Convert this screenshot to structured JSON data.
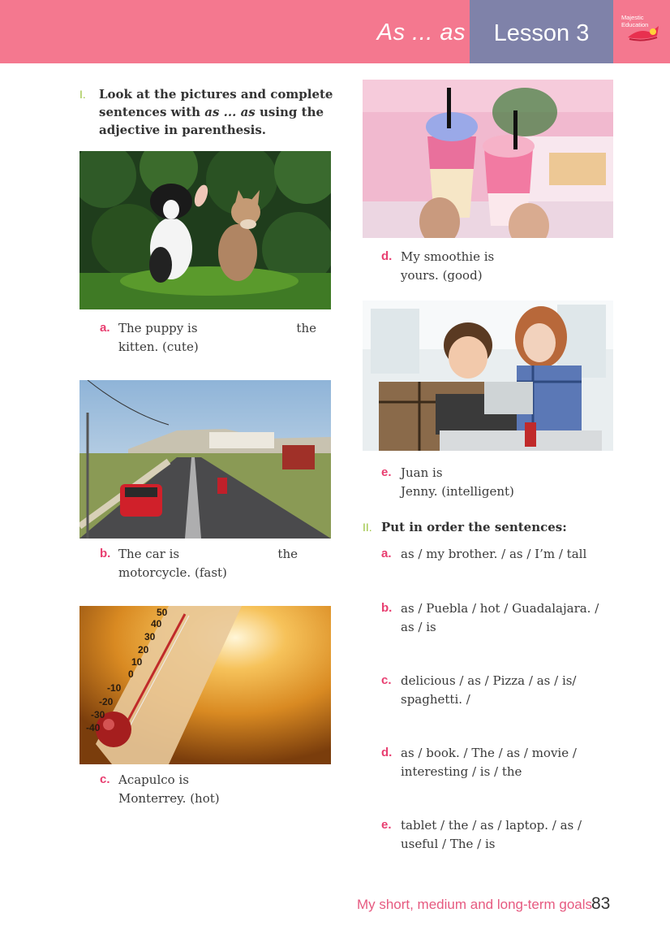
{
  "header": {
    "topic": "As ... as",
    "lesson": "Lesson 3",
    "logo_line1": "Majestic",
    "logo_line2": "Education"
  },
  "section1": {
    "numeral": "I.",
    "line1": "Look at the pictures and complete",
    "line2_pre": "sentences with ",
    "line2_em": "as ... as",
    "line2_post": " using the",
    "line3": "adjective in parenthesis."
  },
  "exercises": [
    {
      "letter": "a.",
      "line1_start": "The puppy is",
      "line1_end": "the",
      "line2": "kitten. (cute)"
    },
    {
      "letter": "b.",
      "line1_start": "The car is",
      "line1_end": "the",
      "line2": "motorcycle. (fast)"
    },
    {
      "letter": "c.",
      "line1_start": "Acapulco is",
      "line1_end": "",
      "line2": "Monterrey. (hot)"
    },
    {
      "letter": "d.",
      "line1_start": "My smoothie is",
      "line1_end": "",
      "line2": "yours. (good)"
    },
    {
      "letter": "e.",
      "line1_start": "Juan is",
      "line1_end": "",
      "line2": "Jenny. (intelligent)"
    }
  ],
  "section2": {
    "numeral": "II.",
    "title": "Put in order the sentences:",
    "items": [
      {
        "letter": "a.",
        "line1": "as / my brother. / as / I’m / tall",
        "line2": ""
      },
      {
        "letter": "b.",
        "line1": "as / Puebla / hot / Guadalajara. /",
        "line2": "as / is"
      },
      {
        "letter": "c.",
        "line1": "delicious / as / Pizza / as / is/",
        "line2": "spaghetti. /"
      },
      {
        "letter": "d.",
        "line1": "as / book. / The / as / movie /",
        "line2": "interesting / is / the"
      },
      {
        "letter": "e.",
        "line1": "tablet / the / as / laptop. / as /",
        "line2": "useful / The / is"
      }
    ]
  },
  "thermometer_scale": [
    "50",
    "40",
    "30",
    "20",
    "10",
    "0",
    "-10",
    "-20",
    "-30",
    "-40"
  ],
  "footer": {
    "text": "My short, medium and long-term goals",
    "page": "83"
  },
  "colors": {
    "header_pink": "#f4788f",
    "lesson_purple": "#7f82a9",
    "accent_pink": "#e83e70",
    "accent_green": "#9bc33e"
  }
}
